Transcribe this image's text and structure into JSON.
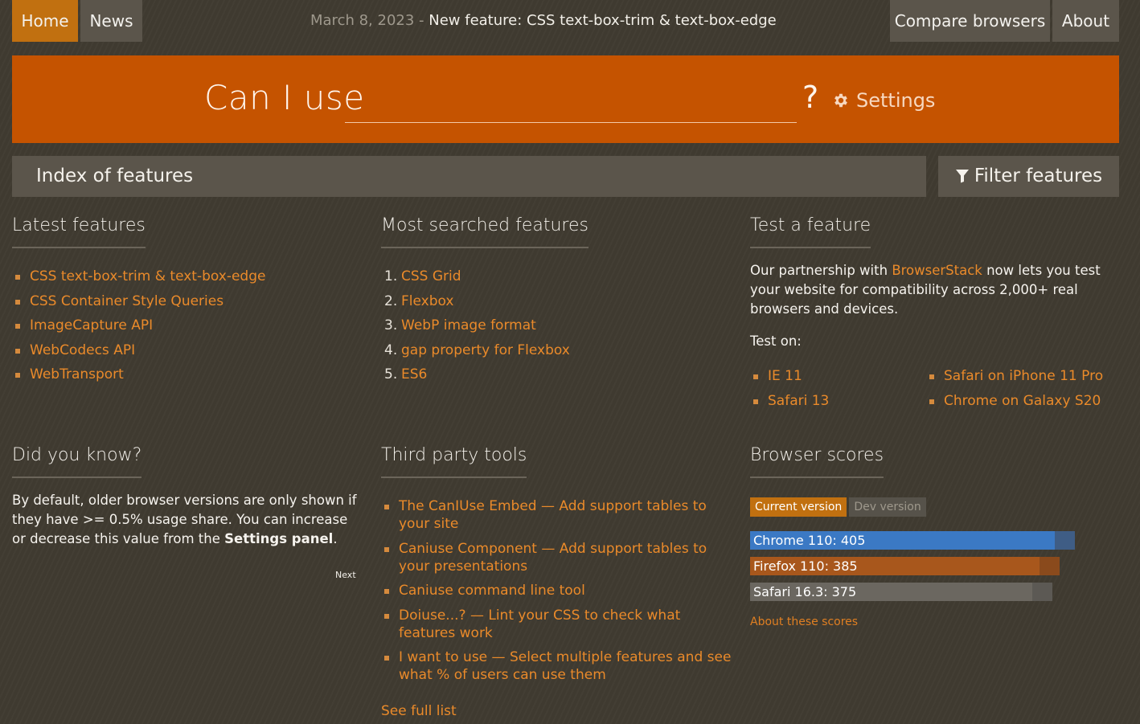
{
  "nav": {
    "home": "Home",
    "news": "News",
    "compare": "Compare browsers",
    "about": "About"
  },
  "announcement": {
    "date": "March 8, 2023",
    "separator": " - ",
    "text": "New feature: CSS text-box-trim & text-box-edge"
  },
  "hero": {
    "title": "Can I use",
    "search_value": "",
    "question": "?",
    "settings_label": "Settings",
    "settings_icon": "gear-icon"
  },
  "index_bar": {
    "title": "Index of features",
    "filter_label": "Filter features",
    "filter_icon": "filter-icon"
  },
  "latest": {
    "heading": "Latest features",
    "items": [
      "CSS text-box-trim & text-box-edge",
      "CSS Container Style Queries",
      "ImageCapture API",
      "WebCodecs API",
      "WebTransport"
    ]
  },
  "most_searched": {
    "heading": "Most searched features",
    "items": [
      {
        "num": "1.",
        "label": "CSS Grid"
      },
      {
        "num": "2.",
        "label": "Flexbox"
      },
      {
        "num": "3.",
        "label": "WebP image format"
      },
      {
        "num": "4.",
        "label": "gap property for Flexbox"
      },
      {
        "num": "5.",
        "label": "ES6"
      }
    ]
  },
  "test_feature": {
    "heading": "Test a feature",
    "text_before": "Our partnership with ",
    "link": "BrowserStack",
    "text_after": " now lets you test your website for compatibility across 2,000+ real browsers and devices.",
    "test_on": "Test on:",
    "targets_left": [
      "IE 11",
      "Safari 13"
    ],
    "targets_right": [
      "Safari on iPhone 11 Pro",
      "Chrome on Galaxy S20"
    ]
  },
  "did_you_know": {
    "heading": "Did you know?",
    "text_before": "By default, older browser versions are only shown if they have >= 0.5% usage share. You can increase or decrease this value from the ",
    "bold": "Settings panel",
    "text_after": ".",
    "next": "Next"
  },
  "third_party": {
    "heading": "Third party tools",
    "items": [
      "The CanIUse Embed — Add support tables to your site",
      "Caniuse Component — Add support tables to your presentations",
      "Caniuse command line tool",
      "Doiuse...? — Lint your CSS to check what features work",
      "I want to use — Select multiple features and see what % of users can use them"
    ],
    "see_full": "See full list"
  },
  "browser_scores": {
    "heading": "Browser scores",
    "tab_current": "Current version",
    "tab_dev": "Dev version",
    "scores": [
      {
        "label": "Chrome 110: 405",
        "score": 405,
        "max": 432,
        "fill": "#3b79c4",
        "track": "#3f5d85"
      },
      {
        "label": "Firefox 110: 385",
        "score": 385,
        "max": 412,
        "fill": "#a8571c",
        "track": "#8a4a1c"
      },
      {
        "label": "Safari 16.3: 375",
        "score": 375,
        "max": 402,
        "fill": "#6b6760",
        "track": "#5c5954"
      }
    ],
    "about_link": "About these scores"
  }
}
